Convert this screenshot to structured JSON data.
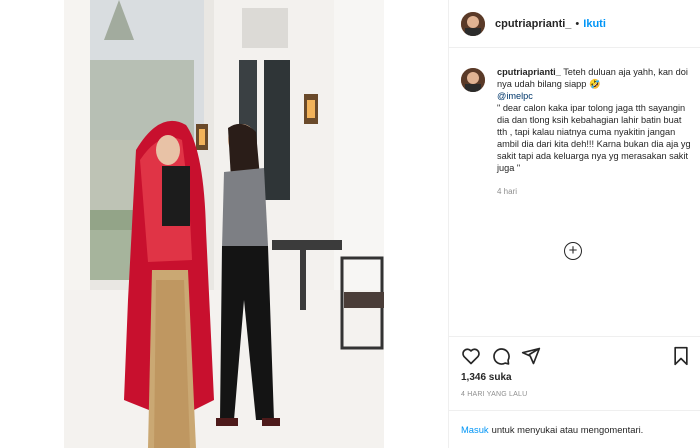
{
  "post": {
    "username": "cputriaprianti_",
    "separator": "•",
    "follow_label": "Ikuti"
  },
  "caption": {
    "username": "cputriaprianti_",
    "line1": "Teteh duluan aja yahh, kan doi nya udah bilang siapp",
    "emoji": "🤣",
    "mention": "@imelpc",
    "quote": "\" dear calon kaka ipar tolong jaga tth sayangin dia dan tlong ksih kebahagian lahir batin buat tth , tapi kalau niatnya cuma nyakitin jangan ambil dia dari kita deh!!! Karna bukan dia aja yg sakit tapi ada keluarga nya yg merasakan sakit juga \"",
    "time_ago": "4 hari"
  },
  "load_more_symbol": "+",
  "actions": {
    "icons": [
      "heart-icon",
      "comment-icon",
      "share-icon",
      "bookmark-icon"
    ]
  },
  "likes_text": "1,346 suka",
  "date_text": "4 HARI YANG LALU",
  "login_prompt": {
    "link": "Masuk",
    "text": "untuk menyukai atau mengomentari."
  }
}
